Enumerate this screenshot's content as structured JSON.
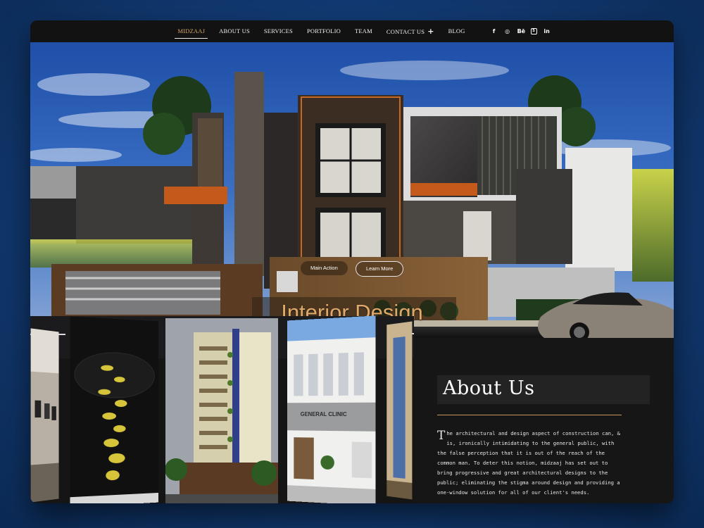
{
  "nav": {
    "items": [
      {
        "label": "MIDZAAJ",
        "active": true
      },
      {
        "label": "ABOUT US"
      },
      {
        "label": "SERVICES"
      },
      {
        "label": "PORTFOLIO"
      },
      {
        "label": "TEAM"
      },
      {
        "label": "CONTACT US"
      },
      {
        "label": "BLOG"
      }
    ],
    "contact_plus": "+",
    "socials": [
      "facebook-icon",
      "instagram-icon",
      "behance-icon",
      "skype-icon",
      "linkedin-icon"
    ],
    "social_glyphs": {
      "facebook": "f",
      "instagram": "◎",
      "behance": "Bē",
      "skype": "S",
      "linkedin": "in"
    }
  },
  "hero": {
    "primary_button": "Main Action",
    "secondary_button": "Learn More",
    "title": "Interior Design"
  },
  "carousel": {
    "clinic_sign": "GENERAL CLINIC"
  },
  "about": {
    "title": "About Us",
    "dropcap": "T",
    "body": "he architectural and design aspect of construction can, & is, ironically intimidating to the general public, with the false perception that it is out of the reach of the common man. To deter this notion, midzaaj has set out to bring progressive and great architectural designs to the public; eliminating the stigma around design and providing a one-window solution for all of our client's needs."
  },
  "colors": {
    "accent": "#d8a46a",
    "title_gold": "#e0a96c",
    "rule": "#c9975e",
    "background_blue": "#123a72"
  }
}
